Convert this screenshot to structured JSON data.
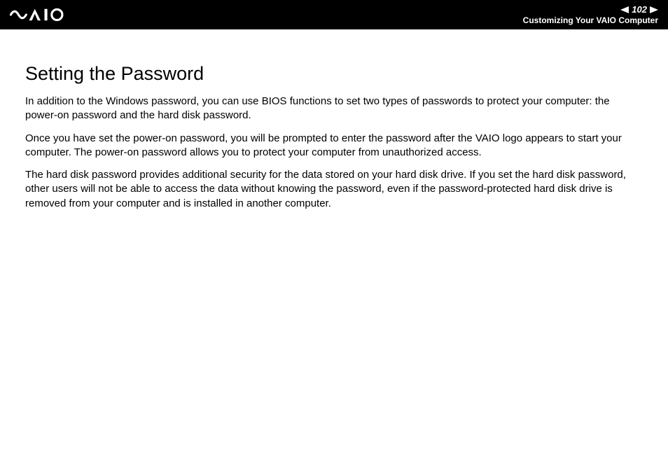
{
  "header": {
    "page_number": "102",
    "section": "Customizing Your VAIO Computer",
    "logo_name": "vaio-logo"
  },
  "content": {
    "title": "Setting the Password",
    "paragraphs": [
      "In addition to the Windows password, you can use BIOS functions to set two types of passwords to protect your computer: the power-on password and the hard disk password.",
      "Once you have set the power-on password, you will be prompted to enter the password after the VAIO logo appears to start your computer. The power-on password allows you to protect your computer from unauthorized access.",
      "The hard disk password provides additional security for the data stored on your hard disk drive. If you set the hard disk password, other users will not be able to access the data without knowing the password, even if the password-protected hard disk drive is removed from your computer and is installed in another computer."
    ]
  }
}
